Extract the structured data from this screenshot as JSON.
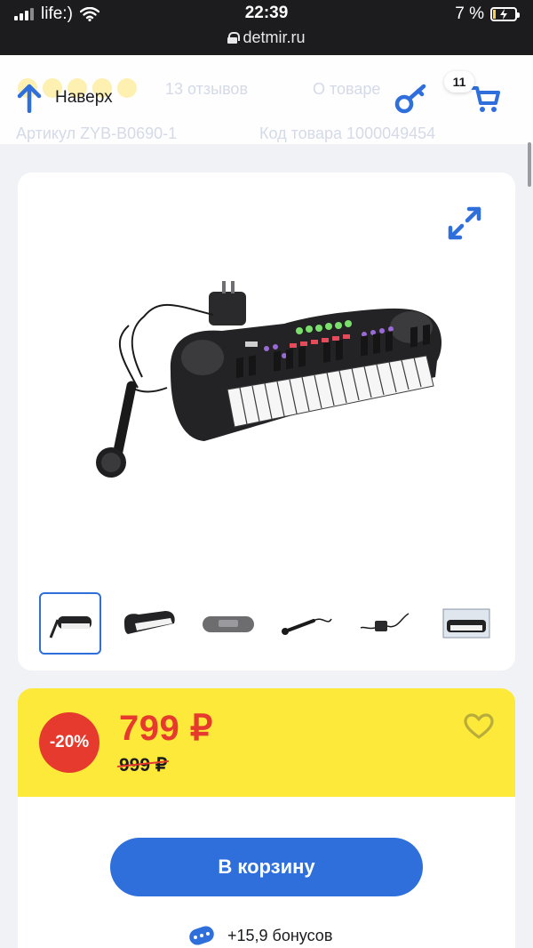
{
  "status_bar": {
    "carrier": "life:)",
    "time": "22:39",
    "url": "detmir.ru",
    "battery": "7 %"
  },
  "header": {
    "back_to_top_label": "Наверх",
    "cart_count": "11",
    "underlay": {
      "reviews": "13 отзывов",
      "about": "О товаре",
      "article": "Артикул ZYB-B0690-1",
      "product_code": "Код товара 1000049454"
    }
  },
  "product": {
    "image_alt": "Синтезатор с микрофоном",
    "thumbnail_count": 6
  },
  "price": {
    "discount": "-20%",
    "current": "799 ₽",
    "old": "999 ₽"
  },
  "actions": {
    "add_to_cart": "В корзину",
    "bonus": "+15,9 бонусов"
  },
  "colors": {
    "accent_blue": "#2e6fdc",
    "sale_red": "#e63a2e",
    "price_yellow": "#fde93a"
  },
  "icons": {
    "back": "arrow-up-icon",
    "key": "key-icon",
    "cart": "cart-icon",
    "expand": "expand-icon",
    "favorite": "heart-icon",
    "bonus": "bonus-chip-icon"
  }
}
